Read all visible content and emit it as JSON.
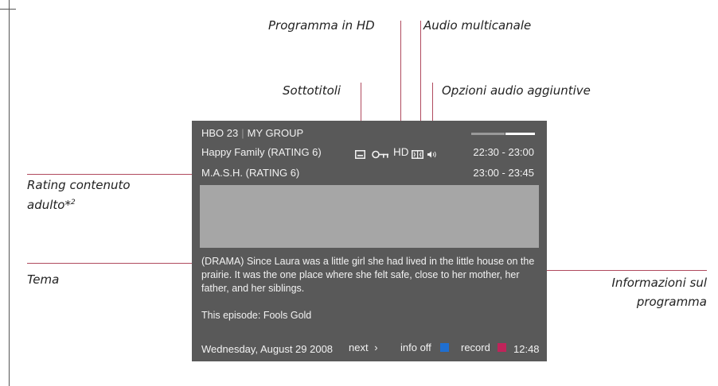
{
  "labels": {
    "hd_program": "Programma in HD",
    "multichannel_audio": "Audio multicanale",
    "subtitles": "Sottotitoli",
    "extra_audio": "Opzioni audio aggiuntive",
    "adult_rating_line1": "Rating contenuto",
    "adult_rating_line2": "adulto*",
    "adult_rating_sup": "2",
    "theme": "Tema",
    "program_info_line1": "Informazioni sul",
    "program_info_line2": "programma"
  },
  "tv": {
    "channel": "HBO 23",
    "separator": "|",
    "group": "MY GROUP",
    "current_program": "Happy Family (RATING 6)",
    "current_time": "22:30 - 23:00",
    "next_program": "M.A.S.H. (RATING 6)",
    "next_time": "23:00 - 23:45",
    "icons": [
      "subtitles-icon",
      "key-icon",
      "hd-icon",
      "dolby-icon",
      "audio-options-icon"
    ],
    "hd_text": "HD",
    "description": "(DRAMA) Since Laura was a little girl she had lived in the little house on the prairie. It was the one place where she felt safe, close to her mother, her father, and her siblings.",
    "episode": "This episode: Fools Gold",
    "date": "Wednesday, August 29 2008",
    "next_button": "next",
    "next_arrow": "›",
    "info_off_button": "info off",
    "record_button": "record",
    "clock": "12:48"
  },
  "colors": {
    "panel": "#595959",
    "leader_lines": "#b04a5e",
    "info_off_key": "#1f6fd1",
    "record_key": "#c0245a",
    "progress_done": "#999999",
    "progress_remaining": "#ffffff"
  }
}
